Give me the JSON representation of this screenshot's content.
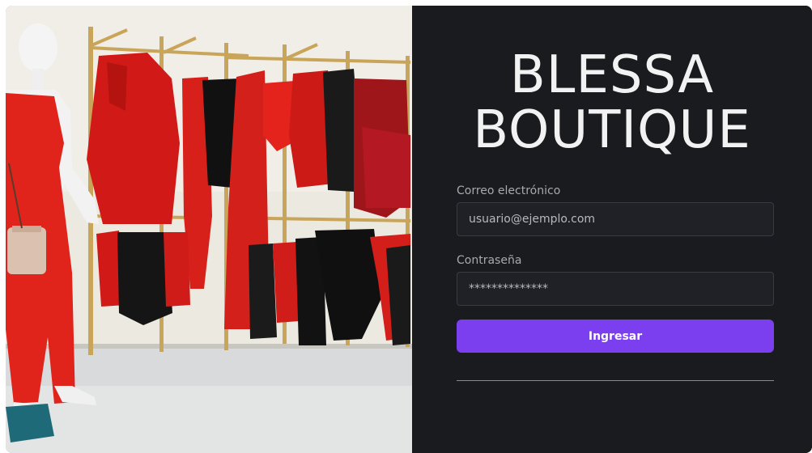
{
  "brand": {
    "line1": "BLESSA",
    "line2": "BOUTIQUE"
  },
  "login": {
    "email_label": "Correo electrónico",
    "email_value": "usuario@ejemplo.com",
    "password_label": "Contraseña",
    "password_value": "**************",
    "submit_label": "Ingresar"
  },
  "colors": {
    "background": "#1a1b1f",
    "accent": "#7b3ff0",
    "text": "#f2f2f2"
  }
}
